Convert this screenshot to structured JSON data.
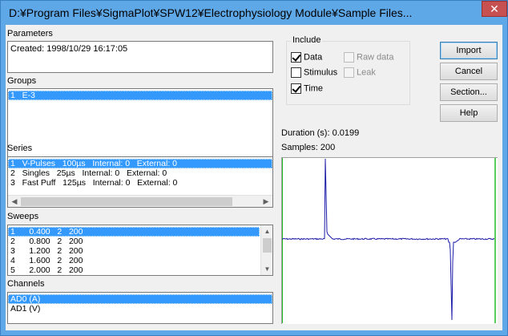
{
  "window": {
    "title": "D:¥Program Files¥SigmaPlot¥SPW12¥Electrophysiology Module¥Sample Files...",
    "close_glyph": "✕"
  },
  "parameters": {
    "label": "Parameters",
    "text": "Created: 1998/10/29 16:17:05"
  },
  "groups": {
    "label": "Groups",
    "items": [
      "1   E-3"
    ]
  },
  "series": {
    "label": "Series",
    "items": [
      "1   V-Pulses   100µs   Internal: 0   External: 0",
      "2   Singles   25µs   Internal: 0   External: 0",
      "3   Fast Puff   125µs   Internal: 0   External: 0"
    ],
    "selected_index": 0
  },
  "sweeps": {
    "label": "Sweeps",
    "items": [
      "1      0.400   2   200",
      "2      0.800   2   200",
      "3      1.200   2   200",
      "4      1.600   2   200",
      "5      2.000   2   200"
    ],
    "selected_index": 0
  },
  "channels": {
    "label": "Channels",
    "items": [
      "AD0 (A)",
      "AD1 (V)"
    ],
    "selected_index": 0
  },
  "include": {
    "label": "Include",
    "data": {
      "label": "Data",
      "checked": true
    },
    "raw_data": {
      "label": "Raw data",
      "checked": false,
      "enabled": false
    },
    "stimulus": {
      "label": "Stimulus",
      "checked": false
    },
    "leak": {
      "label": "Leak",
      "checked": false,
      "enabled": false
    },
    "time": {
      "label": "Time",
      "checked": true
    }
  },
  "buttons": {
    "import": "Import",
    "cancel": "Cancel",
    "section": "Section...",
    "help": "Help"
  },
  "info": {
    "duration": "Duration (s): 0.0199",
    "samples": "Samples: 200"
  },
  "colors": {
    "trace": "#1a1aa8",
    "plot_edge": "#22bb22",
    "selection": "#3399ff"
  }
}
